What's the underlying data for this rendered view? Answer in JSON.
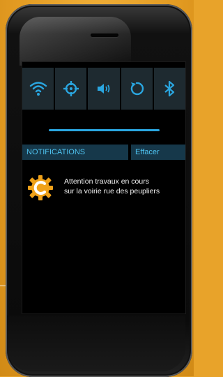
{
  "quick_settings": [
    {
      "icon": "wifi-icon",
      "label": ""
    },
    {
      "icon": "location-icon",
      "label": ""
    },
    {
      "icon": "volume-icon",
      "label": ""
    },
    {
      "icon": "rotate-icon",
      "label": ""
    },
    {
      "icon": "bluetooth-icon",
      "label": ""
    }
  ],
  "brightness_level": 0.75,
  "notifications": {
    "title": "NOTIFICATIONS",
    "clear_label": "Effacer",
    "items": [
      {
        "icon": "warning-gear-icon",
        "line1": "Attention travaux en cours",
        "line2": "sur la voirie rue des peupliers"
      }
    ]
  },
  "colors": {
    "background": "#e8a32a",
    "accent": "#2aa6e0",
    "tile": "#1e2a30",
    "header": "#16384a",
    "gear": "#f0a21a"
  }
}
